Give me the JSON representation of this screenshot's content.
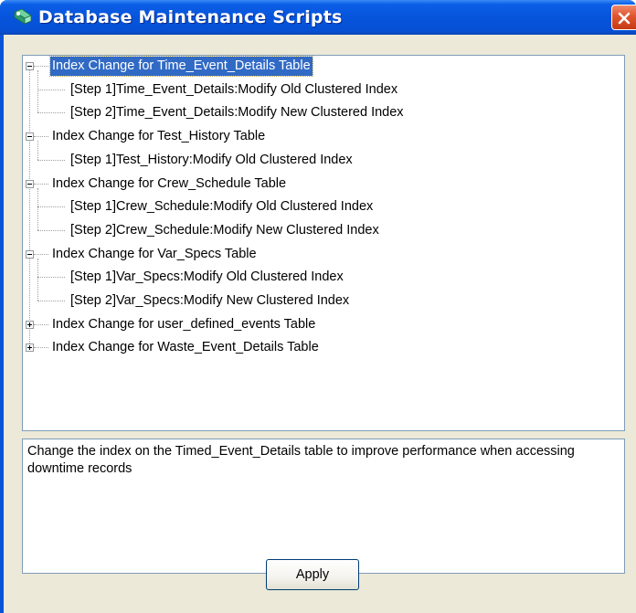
{
  "window": {
    "title": "Database Maintenance Scripts"
  },
  "tree": {
    "nodes": [
      {
        "label": "Index Change for Time_Event_Details Table",
        "expanded": true,
        "selected": true,
        "children": [
          "[Step 1]Time_Event_Details:Modify Old Clustered Index",
          "[Step 2]Time_Event_Details:Modify New Clustered Index"
        ]
      },
      {
        "label": "Index Change for Test_History Table",
        "expanded": true,
        "selected": false,
        "children": [
          "[Step 1]Test_History:Modify Old Clustered Index"
        ]
      },
      {
        "label": "Index Change for Crew_Schedule Table",
        "expanded": true,
        "selected": false,
        "children": [
          "[Step 1]Crew_Schedule:Modify Old Clustered Index",
          "[Step 2]Crew_Schedule:Modify New Clustered Index"
        ]
      },
      {
        "label": "Index Change for Var_Specs Table",
        "expanded": true,
        "selected": false,
        "children": [
          "[Step 1]Var_Specs:Modify Old Clustered Index",
          "[Step 2]Var_Specs:Modify New Clustered Index"
        ]
      },
      {
        "label": "Index Change for user_defined_events Table",
        "expanded": false,
        "selected": false,
        "children": []
      },
      {
        "label": "Index Change for Waste_Event_Details Table",
        "expanded": false,
        "selected": false,
        "children": []
      }
    ]
  },
  "description": {
    "text": "Change the index on the Timed_Event_Details table to improve performance when accessing downtime records"
  },
  "buttons": {
    "apply_label": "Apply"
  },
  "colors": {
    "titlebar": "#0754dc",
    "selection": "#316ac5",
    "close": "#e0542e"
  }
}
